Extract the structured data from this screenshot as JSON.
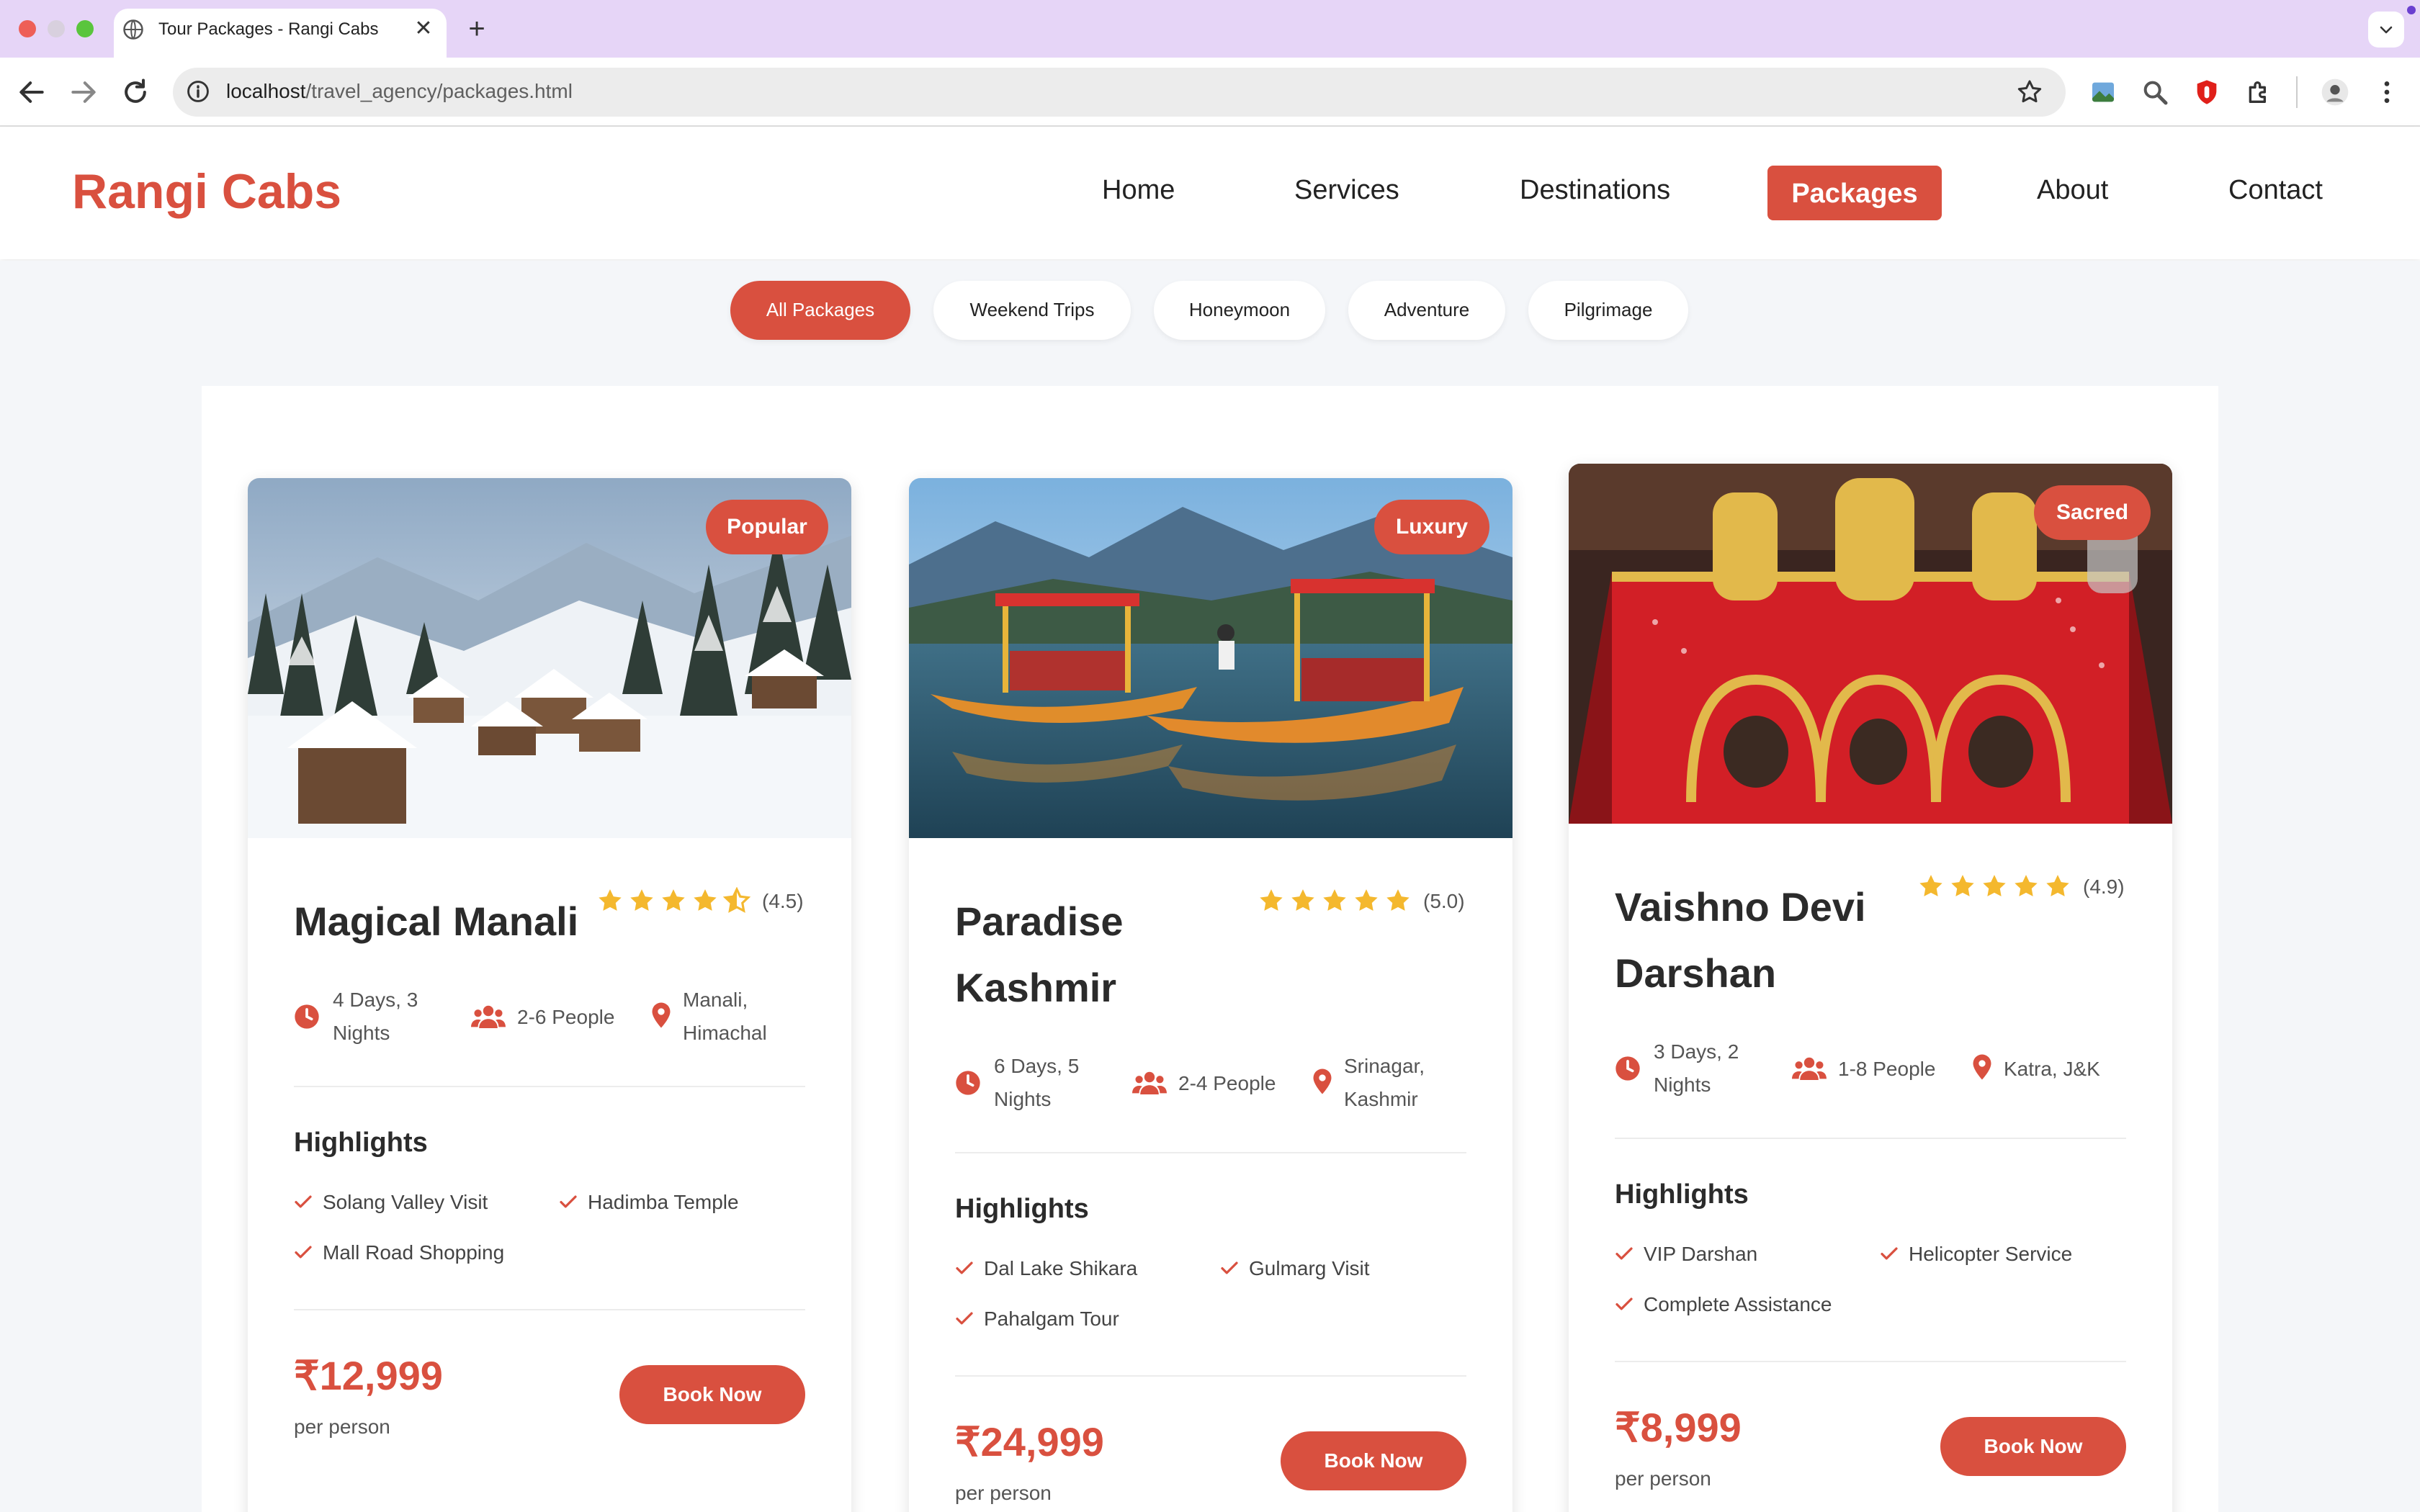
{
  "browser": {
    "tab_title": "Tour Packages - Rangi Cabs",
    "tab_close": "✕",
    "new_tab": "+",
    "url_host": "localhost",
    "url_path": "/travel_agency/packages.html"
  },
  "site": {
    "logo": "Rangi Cabs",
    "nav": [
      "Home",
      "Services",
      "Destinations",
      "Packages",
      "About",
      "Contact"
    ],
    "active_nav": "Packages",
    "brand_color": "#d9503f"
  },
  "filters": {
    "items": [
      "All Packages",
      "Weekend Trips",
      "Honeymoon",
      "Adventure",
      "Pilgrimage"
    ],
    "active": "All Packages"
  },
  "packages": [
    {
      "badge": "Popular",
      "title_lines": [
        "Magical Manali"
      ],
      "rating": 4.5,
      "rating_text": "(4.5)",
      "duration": [
        "4 Days, 3",
        "Nights"
      ],
      "people": "2-6 People",
      "location": [
        "Manali,",
        "Himachal"
      ],
      "highlights_title": "Highlights",
      "highlights": [
        "Solang Valley Visit",
        "Hadimba Temple",
        "Mall Road Shopping"
      ],
      "price": "₹12,999",
      "price_note": "per person",
      "button": "Book Now"
    },
    {
      "badge": "Luxury",
      "title_lines": [
        "Paradise",
        "Kashmir"
      ],
      "rating": 5.0,
      "rating_text": "(5.0)",
      "duration": [
        "6 Days, 5",
        "Nights"
      ],
      "people": "2-4 People",
      "location": [
        "Srinagar,",
        "Kashmir"
      ],
      "highlights_title": "Highlights",
      "highlights": [
        "Dal Lake Shikara",
        "Gulmarg Visit",
        "Pahalgam Tour"
      ],
      "price": "₹24,999",
      "price_note": "per person",
      "button": "Book Now"
    },
    {
      "badge": "Sacred",
      "title_lines": [
        "Vaishno Devi",
        "Darshan"
      ],
      "rating": 4.9,
      "rating_text": "(4.9)",
      "duration": [
        "3 Days, 2",
        "Nights"
      ],
      "people": "1-8 People",
      "location": [
        "Katra, J&K"
      ],
      "highlights_title": "Highlights",
      "highlights": [
        "VIP Darshan",
        "Helicopter Service",
        "Complete Assistance"
      ],
      "price": "₹8,999",
      "price_note": "per person",
      "button": "Book Now"
    }
  ],
  "icons": {
    "duration": "clock-icon",
    "people": "users-icon",
    "location": "map-pin-icon",
    "highlight": "check-icon",
    "rating": "star-icon"
  }
}
